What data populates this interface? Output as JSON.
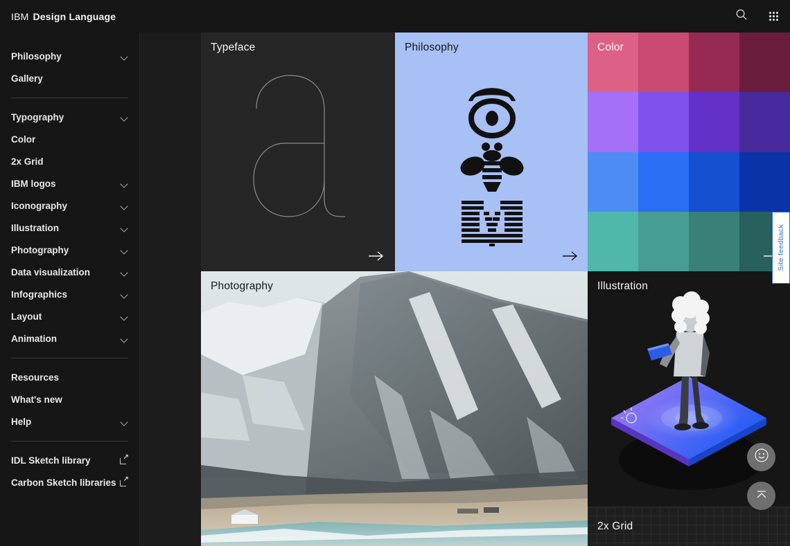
{
  "header": {
    "brand_prefix": "IBM",
    "brand_name": "Design Language",
    "search_icon": "search-icon",
    "apps_icon": "app-grid-icon"
  },
  "sidebar": {
    "groups": [
      {
        "items": [
          {
            "label": "Philosophy",
            "expandable": true
          },
          {
            "label": "Gallery",
            "expandable": false
          }
        ]
      },
      {
        "items": [
          {
            "label": "Typography",
            "expandable": true
          },
          {
            "label": "Color",
            "expandable": false
          },
          {
            "label": "2x Grid",
            "expandable": false
          },
          {
            "label": "IBM logos",
            "expandable": true
          },
          {
            "label": "Iconography",
            "expandable": true
          },
          {
            "label": "Illustration",
            "expandable": true
          },
          {
            "label": "Photography",
            "expandable": true
          },
          {
            "label": "Data visualization",
            "expandable": true
          },
          {
            "label": "Infographics",
            "expandable": true
          },
          {
            "label": "Layout",
            "expandable": true
          },
          {
            "label": "Animation",
            "expandable": true
          }
        ]
      },
      {
        "items": [
          {
            "label": "Resources",
            "expandable": false
          },
          {
            "label": "What's new",
            "expandable": false
          },
          {
            "label": "Help",
            "expandable": true
          }
        ]
      },
      {
        "items": [
          {
            "label": "IDL Sketch library",
            "external": true
          },
          {
            "label": "Carbon Sketch libraries",
            "external": true
          }
        ]
      }
    ]
  },
  "cards": {
    "typeface": {
      "title": "Typeface",
      "arrow": "arrow-right-icon",
      "background": "#262626"
    },
    "philosophy": {
      "title": "Philosophy",
      "arrow": "arrow-right-icon",
      "background": "#a7c0f5"
    },
    "color": {
      "title": "Color",
      "arrow": "arrow-right-icon"
    },
    "photography": {
      "title": "Photography",
      "arrow": "arrow-right-icon"
    },
    "illustration": {
      "title": "Illustration"
    },
    "grid2x": {
      "title": "2x Grid"
    }
  },
  "color_swatches": [
    "#dd6085",
    "#ca4a70",
    "#972a53",
    "#6b1d3c",
    "#a370f7",
    "#8151ee",
    "#6331c9",
    "#472a9c",
    "#4d8cf5",
    "#2a6ef5",
    "#1450cf",
    "#0b33a8",
    "#4fb8ab",
    "#479d92",
    "#398079",
    "#27605c"
  ],
  "widgets": {
    "feedback_tab_label": "Site feedback",
    "fab_feedback_icon": "smiley-face-icon",
    "fab_top_icon": "back-to-top-icon"
  }
}
